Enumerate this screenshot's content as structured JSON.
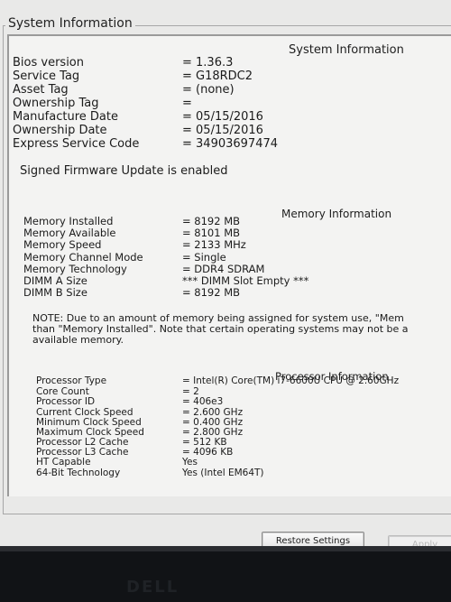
{
  "window": {
    "title": "System Information"
  },
  "system_info": {
    "heading": "System Information",
    "rows": [
      {
        "label": "Bios version",
        "value": "= 1.36.3"
      },
      {
        "label": "Service Tag",
        "value": "= G18RDC2"
      },
      {
        "label": "Asset Tag",
        "value": "= (none)"
      },
      {
        "label": "Ownership Tag",
        "value": "="
      },
      {
        "label": "Manufacture Date",
        "value": "= 05/15/2016"
      },
      {
        "label": "Ownership Date",
        "value": "= 05/15/2016"
      },
      {
        "label": "Express Service Code",
        "value": "= 34903697474"
      }
    ],
    "firmware_note": "Signed Firmware Update is enabled"
  },
  "memory_info": {
    "heading": "Memory Information",
    "rows": [
      {
        "label": "Memory Installed",
        "value": "= 8192 MB"
      },
      {
        "label": "Memory Available",
        "value": "= 8101 MB"
      },
      {
        "label": "Memory Speed",
        "value": "= 2133 MHz"
      },
      {
        "label": "Memory Channel Mode",
        "value": "= Single"
      },
      {
        "label": "Memory Technology",
        "value": "= DDR4 SDRAM"
      },
      {
        "label": "DIMM A Size",
        "value": "*** DIMM Slot Empty ***"
      },
      {
        "label": "DIMM B Size",
        "value": "= 8192 MB"
      }
    ],
    "note_lines": [
      "NOTE: Due to an amount of memory being assigned for system use, \"Mem",
      "than \"Memory Installed\". Note that certain operating systems may not be a",
      "available memory."
    ]
  },
  "processor_info": {
    "heading": "Processor Information",
    "rows": [
      {
        "label": "Processor Type",
        "value": "= Intel(R) Core(TM) i7-6600U CPU @ 2.60GHz"
      },
      {
        "label": "Core Count",
        "value": "= 2"
      },
      {
        "label": "Processor ID",
        "value": "= 406e3"
      },
      {
        "label": "Current Clock Speed",
        "value": "= 2.600 GHz"
      },
      {
        "label": "Minimum Clock Speed",
        "value": "= 0.400 GHz"
      },
      {
        "label": "Maximum Clock Speed",
        "value": "= 2.800 GHz"
      },
      {
        "label": "Processor L2 Cache",
        "value": "= 512 KB"
      },
      {
        "label": "Processor L3 Cache",
        "value": "= 4096 KB"
      },
      {
        "label": "HT Capable",
        "value": "Yes"
      },
      {
        "label": "64-Bit Technology",
        "value": "Yes (Intel EM64T)"
      }
    ]
  },
  "buttons": {
    "restore": "Restore Settings",
    "apply": "Apply"
  },
  "bezel": {
    "brand": "DELL"
  }
}
